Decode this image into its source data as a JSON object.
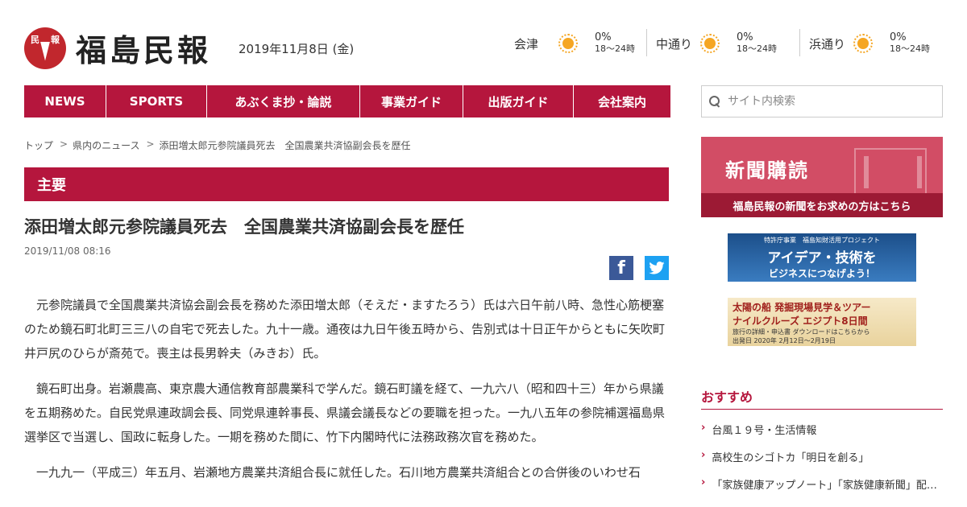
{
  "brand": {
    "name": "福島民報",
    "badge_left": "民",
    "badge_right": "報"
  },
  "date": "2019年11月8日 (金)",
  "weather": [
    {
      "region": "会津",
      "precip": "0%",
      "temp": "18～24時",
      "icon": "sun-icon"
    },
    {
      "region": "中通り",
      "precip": "0%",
      "temp": "18～24時",
      "icon": "sun-icon"
    },
    {
      "region": "浜通り",
      "precip": "0%",
      "temp": "18～24時",
      "icon": "sun-icon"
    }
  ],
  "nav": [
    {
      "label": "NEWS"
    },
    {
      "label": "SPORTS"
    },
    {
      "label": "あぶくま抄・論説"
    },
    {
      "label": "事業ガイド"
    },
    {
      "label": "出版ガイド"
    },
    {
      "label": "会社案内"
    }
  ],
  "search": {
    "placeholder": "サイト内検索"
  },
  "breadcrumb": {
    "home": "トップ",
    "sep": ">",
    "category": "県内のニュース",
    "current": "添田増太郎元参院議員死去　全国農業共済協副会長を歴任"
  },
  "section": "主要",
  "article": {
    "title": "添田増太郎元参院議員死去　全国農業共済協副会長を歴任",
    "timestamp": "2019/11/08 08:16",
    "paragraphs": [
      "元参院議員で全国農業共済協会副会長を務めた添田増太郎（そえだ・ますたろう）氏は六日午前八時、急性心筋梗塞のため鏡石町北町三三八の自宅で死去した。九十一歳。通夜は九日午後五時から、告別式は十日正午からともに矢吹町井戸尻のひらが斎苑で。喪主は長男幹夫（みきお）氏。",
      "鏡石町出身。岩瀬農高、東京農大通信教育部農業科で学んだ。鏡石町議を経て、一九六八（昭和四十三）年から県議を五期務めた。自民党県連政調会長、同党県連幹事長、県議会議長などの要職を担った。一九八五年の参院補選福島県選挙区で当選し、国政に転身した。一期を務めた間に、竹下内閣時代に法務政務次官を務めた。",
      "一九九一（平成三）年五月、岩瀬地方農業共済組合長に就任した。石川地方農業共済組合との合併後のいわせ石"
    ]
  },
  "share": {
    "facebook": "f",
    "twitter": "t"
  },
  "subscribe": {
    "title": "新聞購読",
    "link": "福島民報の新聞をお求めの方はこちら"
  },
  "banner1": {
    "small": "特許庁事業　福島知財活用プロジェクト",
    "big": "アイデア・技術を",
    "sub": "ビジネスにつなげよう！"
  },
  "banner2": {
    "line1": "太陽の船 発掘現場見学＆ツアー",
    "line2": "ナイルクルーズ エジプト8日間",
    "line3": "旅行の詳細・申込書 ダウンロードはこちらから",
    "line4": "出発日 2020年 2月12日～2月19日"
  },
  "recommend": {
    "title": "おすすめ",
    "items": [
      "台風１９号・生活情報",
      "高校生のシゴトカ「明日を創る」",
      "「家族健康アップノート」「家族健康新聞」配…"
    ]
  },
  "colors": {
    "accent": "#b5163d",
    "subscribe_bg": "#d24d65",
    "facebook": "#3b5998",
    "twitter": "#1da1f2"
  }
}
